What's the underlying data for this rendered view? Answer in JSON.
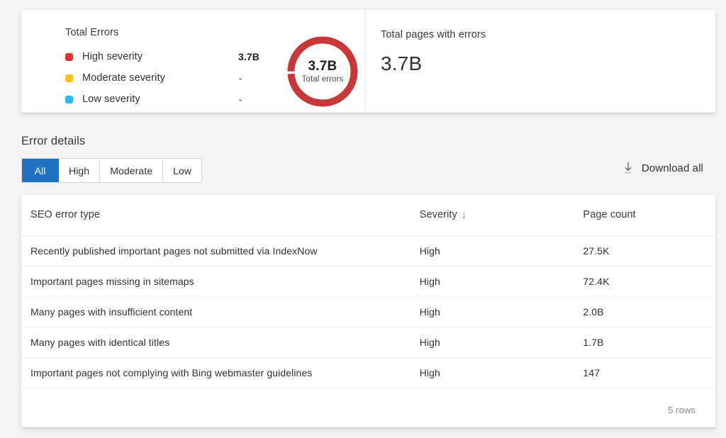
{
  "summary": {
    "legend_title": "Total Errors",
    "legend": [
      {
        "label": "High severity",
        "value": "3.7B",
        "color": "#d93434"
      },
      {
        "label": "Moderate severity",
        "value": "-",
        "color": "#fbbf24"
      },
      {
        "label": "Low severity",
        "value": "-",
        "color": "#2fb6ea"
      }
    ],
    "donut": {
      "value": "3.7B",
      "caption": "Total errors",
      "ring_color": "#c8383b",
      "track_color": "#ffffff"
    },
    "kpi": {
      "title": "Total pages with errors",
      "value": "3.7B"
    }
  },
  "details": {
    "section_title": "Error details",
    "tabs": [
      {
        "label": "All",
        "active": true
      },
      {
        "label": "High",
        "active": false
      },
      {
        "label": "Moderate",
        "active": false
      },
      {
        "label": "Low",
        "active": false
      }
    ],
    "active_tab_color": "#1f72c4",
    "download": {
      "label": "Download all",
      "icon": "download-icon"
    },
    "table": {
      "columns": [
        "SEO error type",
        "Severity",
        "Page count"
      ],
      "sort_column": "Severity",
      "sort_direction": "descending",
      "sort_icon": "↓",
      "severity_high_color": "#e04e4e",
      "rows": [
        {
          "type": "Recently published important pages not submitted via IndexNow",
          "severity": "High",
          "count": "27.5K"
        },
        {
          "type": "Important pages missing in sitemaps",
          "severity": "High",
          "count": "72.4K"
        },
        {
          "type": "Many pages with insufficient content",
          "severity": "High",
          "count": "2.0B"
        },
        {
          "type": "Many pages with identical titles",
          "severity": "High",
          "count": "1.7B"
        },
        {
          "type": "Important pages not complying with Bing webmaster guidelines",
          "severity": "High",
          "count": "147"
        }
      ],
      "footer": "5 rows"
    }
  },
  "chart_data": {
    "type": "pie",
    "title": "Total Errors",
    "categories": [
      "High severity",
      "Moderate severity",
      "Low severity"
    ],
    "values": [
      3700000000,
      0,
      0
    ],
    "value_labels": [
      "3.7B",
      "-",
      "-"
    ],
    "colors": [
      "#d93434",
      "#fbbf24",
      "#2fb6ea"
    ],
    "center_label": "3.7B",
    "center_sublabel": "Total errors",
    "total": "3.7B",
    "legend_position": "left",
    "donut": true
  }
}
